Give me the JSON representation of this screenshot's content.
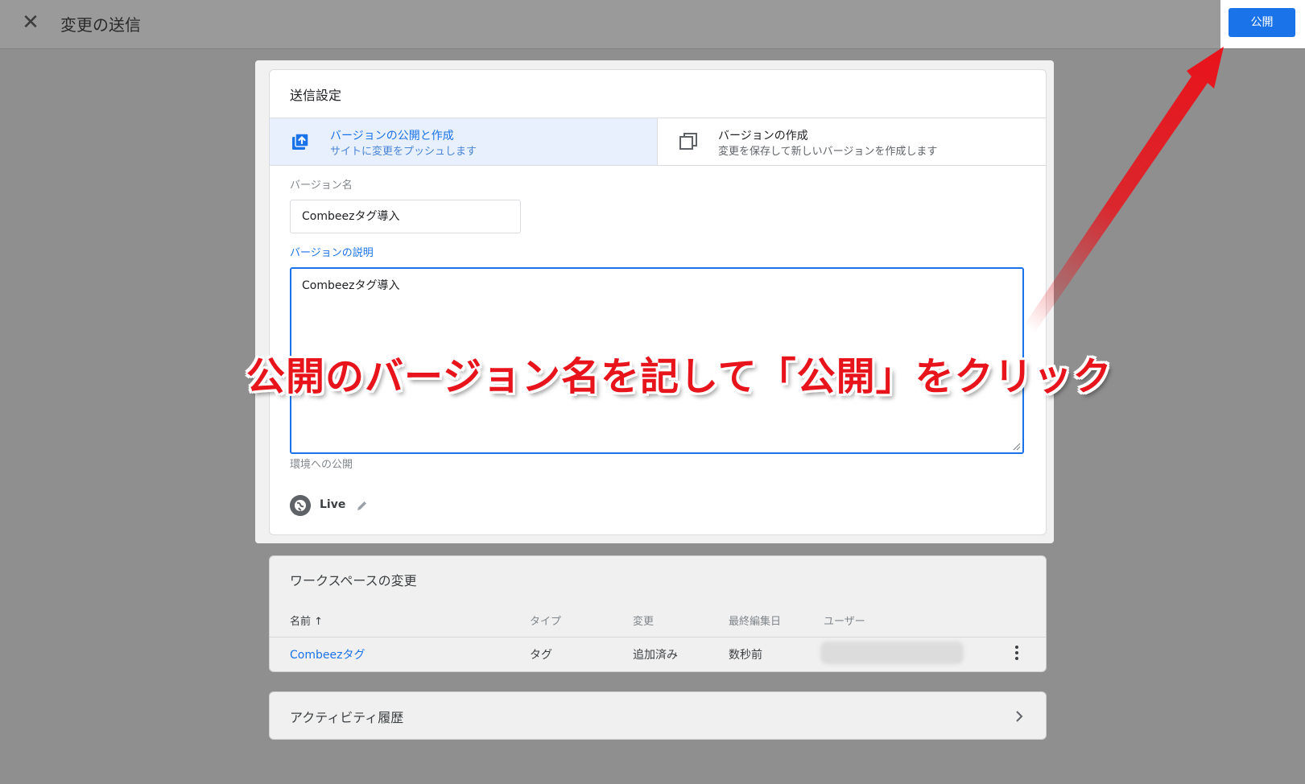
{
  "header": {
    "close_icon": "close-icon",
    "title": "変更の送信",
    "publish_label": "公開"
  },
  "submission": {
    "title": "送信設定",
    "options": [
      {
        "title": "バージョンの公開と作成",
        "subtitle": "サイトに変更をプッシュします",
        "icon": "publish-icon",
        "selected": true
      },
      {
        "title": "バージョンの作成",
        "subtitle": "変更を保存して新しいバージョンを作成します",
        "icon": "copy-icon",
        "selected": false
      }
    ],
    "version_name_label": "バージョン名",
    "version_name_value": "Combeezタグ導入",
    "version_desc_label": "バージョンの説明",
    "version_desc_value": "Combeezタグ導入",
    "env_label": "環境への公開",
    "env_name": "Live"
  },
  "workspace_changes": {
    "title": "ワークスペースの変更",
    "columns": [
      "名前 ↑",
      "タイプ",
      "変更",
      "最終編集日",
      "ユーザー"
    ],
    "rows": [
      {
        "name": "Combeezタグ",
        "type": "タグ",
        "change": "追加済み",
        "edited": "数秒前",
        "user": ""
      }
    ]
  },
  "activity": {
    "title": "アクティビティ履歴"
  },
  "annotation": {
    "text": "公開のバージョン名を記して「公開」をクリック",
    "color": "#e8141c"
  },
  "colors": {
    "accent": "#1a73e8",
    "overlay": "#8f8f8f"
  }
}
